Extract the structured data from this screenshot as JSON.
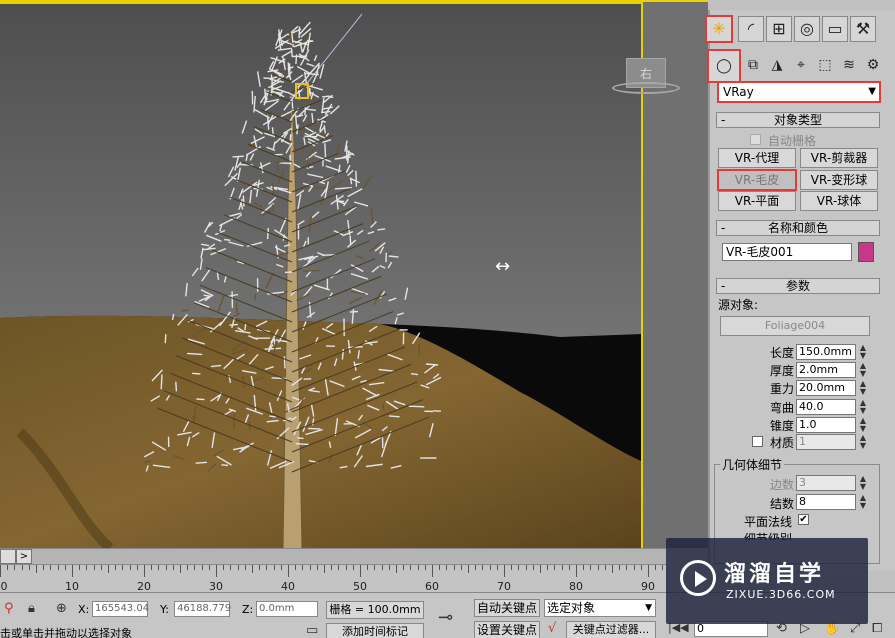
{
  "viewport": {
    "viewcube_label": "右"
  },
  "command_panel": {
    "renderer_dropdown": "VRay",
    "rollout_object_type": "对象类型",
    "auto_grid": "自动栅格",
    "buttons": [
      "VR-代理",
      "VR-剪裁器",
      "VR-毛皮",
      "VR-变形球",
      "VR-平面",
      "VR-球体"
    ],
    "rollout_name_color": "名称和颜色",
    "object_name": "VR-毛皮001",
    "swatch_color": "#c8388a",
    "rollout_params": "参数",
    "source_object_label": "源对象:",
    "source_object": "Foliage004",
    "params": [
      {
        "label": "长度",
        "value": "150.0mm"
      },
      {
        "label": "厚度",
        "value": "2.0mm"
      },
      {
        "label": "重力",
        "value": "20.0mm"
      },
      {
        "label": "弯曲",
        "value": "40.0"
      },
      {
        "label": "锥度",
        "value": "1.0"
      }
    ],
    "material_label": "材质",
    "material_value": "1",
    "geometry_group": "几何体细节",
    "sides_label": "边数",
    "sides_value": "3",
    "knots_label": "结数",
    "knots_value": "8",
    "flat_normals": "平面法线",
    "flat_normals_checked": "✔",
    "partial_next": "细节级别"
  },
  "timeline": {
    "ticks": [
      "0",
      "10",
      "20",
      "30",
      "40",
      "50",
      "60",
      "70",
      "80",
      "90",
      "100"
    ],
    "next_glyph": ">"
  },
  "status": {
    "x_label": "X:",
    "x_value": "165543.04",
    "y_label": "Y:",
    "y_value": "46188.779",
    "z_label": "Z:",
    "z_value": "0.0mm",
    "grid": "栅格 = 100.0mm",
    "auto_key": "自动关键点",
    "selected_objects": "选定对象",
    "set_key": "设置关键点",
    "key_filters": "关键点过滤器...",
    "frame": "0",
    "prompt": "击或单击并拖动以选择对象",
    "add_time_tag": "添加时间标记"
  },
  "watermark": {
    "title": "溜溜自学",
    "url": "ZIXUE.3D66.COM"
  }
}
